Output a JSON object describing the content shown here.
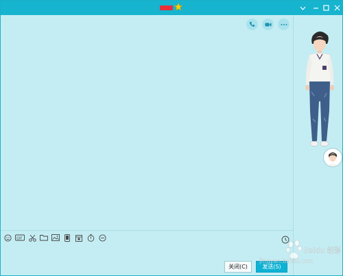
{
  "window": {
    "accent": "#16b4cf",
    "background": "#c4edf3"
  },
  "title_bar": {
    "controls": [
      "chevron-down-icon",
      "minimize-icon",
      "maximize-icon",
      "close-icon"
    ]
  },
  "chat_header_actions": [
    "phone-icon",
    "video-icon",
    "more-icon"
  ],
  "input_toolbar": {
    "tools": [
      "emoji-icon",
      "gif-icon",
      "scissors-icon",
      "folder-icon",
      "image-icon",
      "phone-screen-icon",
      "calendar-icon",
      "stopwatch-icon",
      "minus-circle-icon"
    ],
    "history_icon": "clock-icon"
  },
  "buttons": {
    "close_label": "关闭(C)",
    "send_label": "发送(S)"
  },
  "watermark": {
    "main": "Baidu 经验",
    "url": "jingyan.baidu.com"
  }
}
